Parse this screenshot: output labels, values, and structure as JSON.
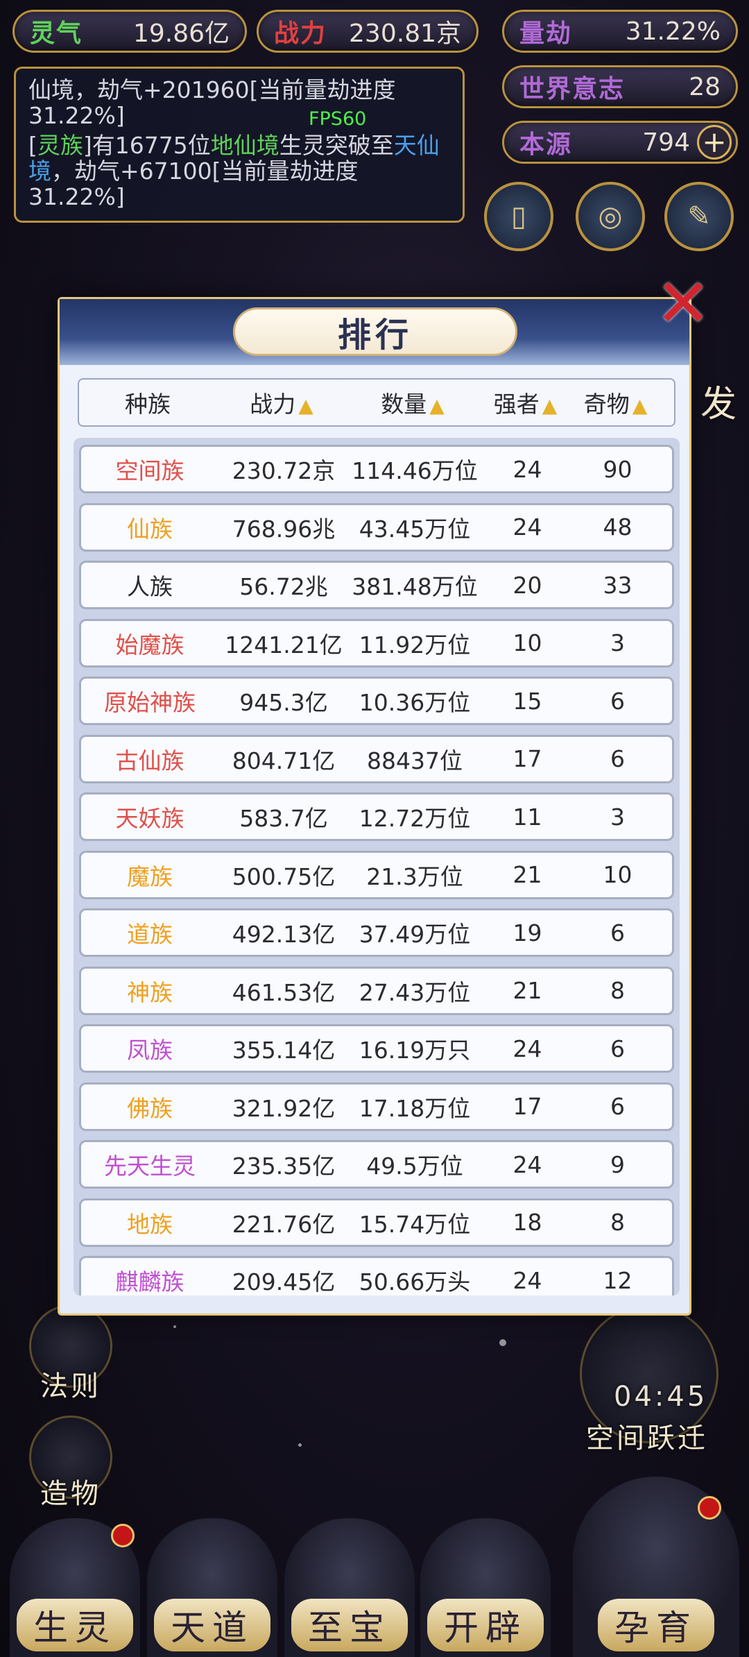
{
  "top_stats": {
    "lingqi": {
      "label": "灵气",
      "value": "19.86亿"
    },
    "zhanli": {
      "label": "战力",
      "value": "230.81京"
    },
    "liangjie": {
      "label": "量劫",
      "value": "31.22%"
    },
    "shijie": {
      "label": "世界意志",
      "value": "28"
    },
    "benyuan": {
      "label": "本源",
      "value": "794",
      "plus": "+"
    }
  },
  "log": {
    "line1": "仙境，劫气+201960[当前量劫进度31.22%]",
    "line2_a": "[",
    "line2_b": "灵族",
    "line2_c": "]有16775位",
    "line2_d": "地仙境",
    "line2_e": "生灵突破至",
    "line2_f": "天仙境",
    "line2_g": "，劫气+67100[当前量劫进度31.22%]",
    "fps": "FPS60"
  },
  "side_left": {
    "fa": "法则",
    "zao": "造物"
  },
  "side_right": {
    "timer": "04:45",
    "label": "空间跃迁",
    "burst": "发"
  },
  "bottom_nav": [
    "生灵",
    "天道",
    "至宝",
    "开辟",
    "孕育"
  ],
  "modal": {
    "title": "排行",
    "close_icon": "close-x-icon",
    "headers": [
      "种族",
      "战力",
      "数量",
      "强者",
      "奇物"
    ],
    "sort_icon": "▲",
    "rows": [
      {
        "name": "空间族",
        "power": "230.72京",
        "count": "114.46万位",
        "strong": "24",
        "items": "90",
        "color": "#e0504a"
      },
      {
        "name": "仙族",
        "power": "768.96兆",
        "count": "43.45万位",
        "strong": "24",
        "items": "48",
        "color": "#f0a020"
      },
      {
        "name": "人族",
        "power": "56.72兆",
        "count": "381.48万位",
        "strong": "20",
        "items": "33",
        "color": "#2b2b30"
      },
      {
        "name": "始魔族",
        "power": "1241.21亿",
        "count": "11.92万位",
        "strong": "10",
        "items": "3",
        "color": "#e0504a"
      },
      {
        "name": "原始神族",
        "power": "945.3亿",
        "count": "10.36万位",
        "strong": "15",
        "items": "6",
        "color": "#e0504a"
      },
      {
        "name": "古仙族",
        "power": "804.71亿",
        "count": "88437位",
        "strong": "17",
        "items": "6",
        "color": "#e0504a"
      },
      {
        "name": "天妖族",
        "power": "583.7亿",
        "count": "12.72万位",
        "strong": "11",
        "items": "3",
        "color": "#e0504a"
      },
      {
        "name": "魔族",
        "power": "500.75亿",
        "count": "21.3万位",
        "strong": "21",
        "items": "10",
        "color": "#f0a020"
      },
      {
        "name": "道族",
        "power": "492.13亿",
        "count": "37.49万位",
        "strong": "19",
        "items": "6",
        "color": "#f0a020"
      },
      {
        "name": "神族",
        "power": "461.53亿",
        "count": "27.43万位",
        "strong": "21",
        "items": "8",
        "color": "#f0a020"
      },
      {
        "name": "凤族",
        "power": "355.14亿",
        "count": "16.19万只",
        "strong": "24",
        "items": "6",
        "color": "#c050d0"
      },
      {
        "name": "佛族",
        "power": "321.92亿",
        "count": "17.18万位",
        "strong": "17",
        "items": "6",
        "color": "#f0a020"
      },
      {
        "name": "先天生灵",
        "power": "235.35亿",
        "count": "49.5万位",
        "strong": "24",
        "items": "9",
        "color": "#c050d0"
      },
      {
        "name": "地族",
        "power": "221.76亿",
        "count": "15.74万位",
        "strong": "18",
        "items": "8",
        "color": "#f0a020"
      },
      {
        "name": "麒麟族",
        "power": "209.45亿",
        "count": "50.66万头",
        "strong": "24",
        "items": "12",
        "color": "#c050d0"
      }
    ]
  }
}
